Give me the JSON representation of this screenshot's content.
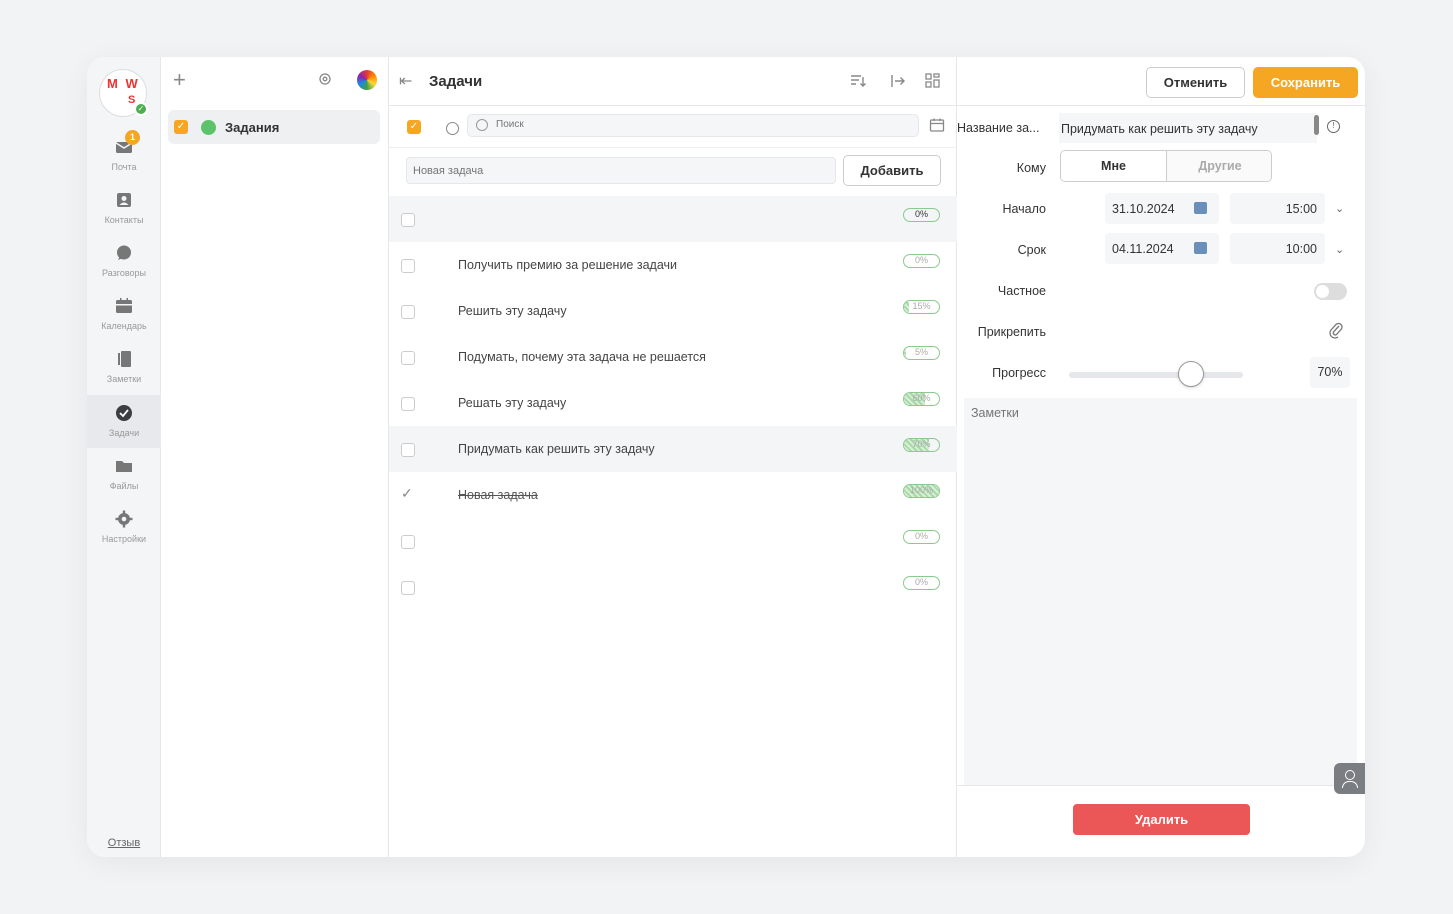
{
  "rail": {
    "avatar_text": "M W",
    "avatar_sub": "S",
    "items": [
      {
        "label": "Почта",
        "icon": "mail-icon",
        "badge": "1"
      },
      {
        "label": "Контакты",
        "icon": "contacts-icon"
      },
      {
        "label": "Разговоры",
        "icon": "chat-icon"
      },
      {
        "label": "Календарь",
        "icon": "calendar-icon"
      },
      {
        "label": "Заметки",
        "icon": "notes-icon"
      },
      {
        "label": "Задачи",
        "icon": "tasks-icon",
        "active": true
      },
      {
        "label": "Файлы",
        "icon": "files-icon"
      },
      {
        "label": "Настройки",
        "icon": "settings-icon"
      }
    ],
    "feedback": "Отзыв"
  },
  "folders": {
    "items": [
      {
        "label": "Задания",
        "color": "#5cc36b",
        "checked": true
      }
    ]
  },
  "tasks": {
    "title": "Задачи",
    "search_placeholder": "Поиск",
    "new_task_placeholder": "Новая задача",
    "add_label": "Добавить",
    "items": [
      {
        "text": "",
        "percent": "0%",
        "progress": 0,
        "done": false,
        "highlight": true
      },
      {
        "text": "Получить премию за решение задачи",
        "percent": "0%",
        "progress": 0,
        "done": false
      },
      {
        "text": "Решить эту задачу",
        "percent": "15%",
        "progress": 15,
        "done": false
      },
      {
        "text": "Подумать, почему эта задача не решается",
        "percent": "5%",
        "progress": 5,
        "done": false
      },
      {
        "text": "Решать эту задачу",
        "percent": "60%",
        "progress": 60,
        "done": false
      },
      {
        "text": "Придумать как решить эту задачу",
        "percent": "70%",
        "progress": 70,
        "done": false,
        "highlight": true
      },
      {
        "text": "Новая задача",
        "percent": "100%",
        "progress": 100,
        "done": true
      },
      {
        "text": "",
        "percent": "0%",
        "progress": 0,
        "done": false
      },
      {
        "text": "",
        "percent": "0%",
        "progress": 0,
        "done": false
      }
    ]
  },
  "detail": {
    "cancel_label": "Отменить",
    "save_label": "Сохранить",
    "name_label": "Название за...",
    "name_value": "Придумать как решить эту задачу",
    "to_label": "Кому",
    "to_me": "Мне",
    "to_others": "Другие",
    "start_label": "Начало",
    "start_date": "31.10.2024",
    "start_time": "15:00",
    "due_label": "Срок",
    "due_date": "04.11.2024",
    "due_time": "10:00",
    "private_label": "Частное",
    "attach_label": "Прикрепить",
    "progress_label": "Прогресс",
    "progress_value": "70%",
    "progress": 70,
    "notes_placeholder": "Заметки",
    "delete_label": "Удалить"
  },
  "colors": {
    "accent": "#f5a623",
    "danger": "#eb5757",
    "folder_green": "#5cc36b"
  }
}
